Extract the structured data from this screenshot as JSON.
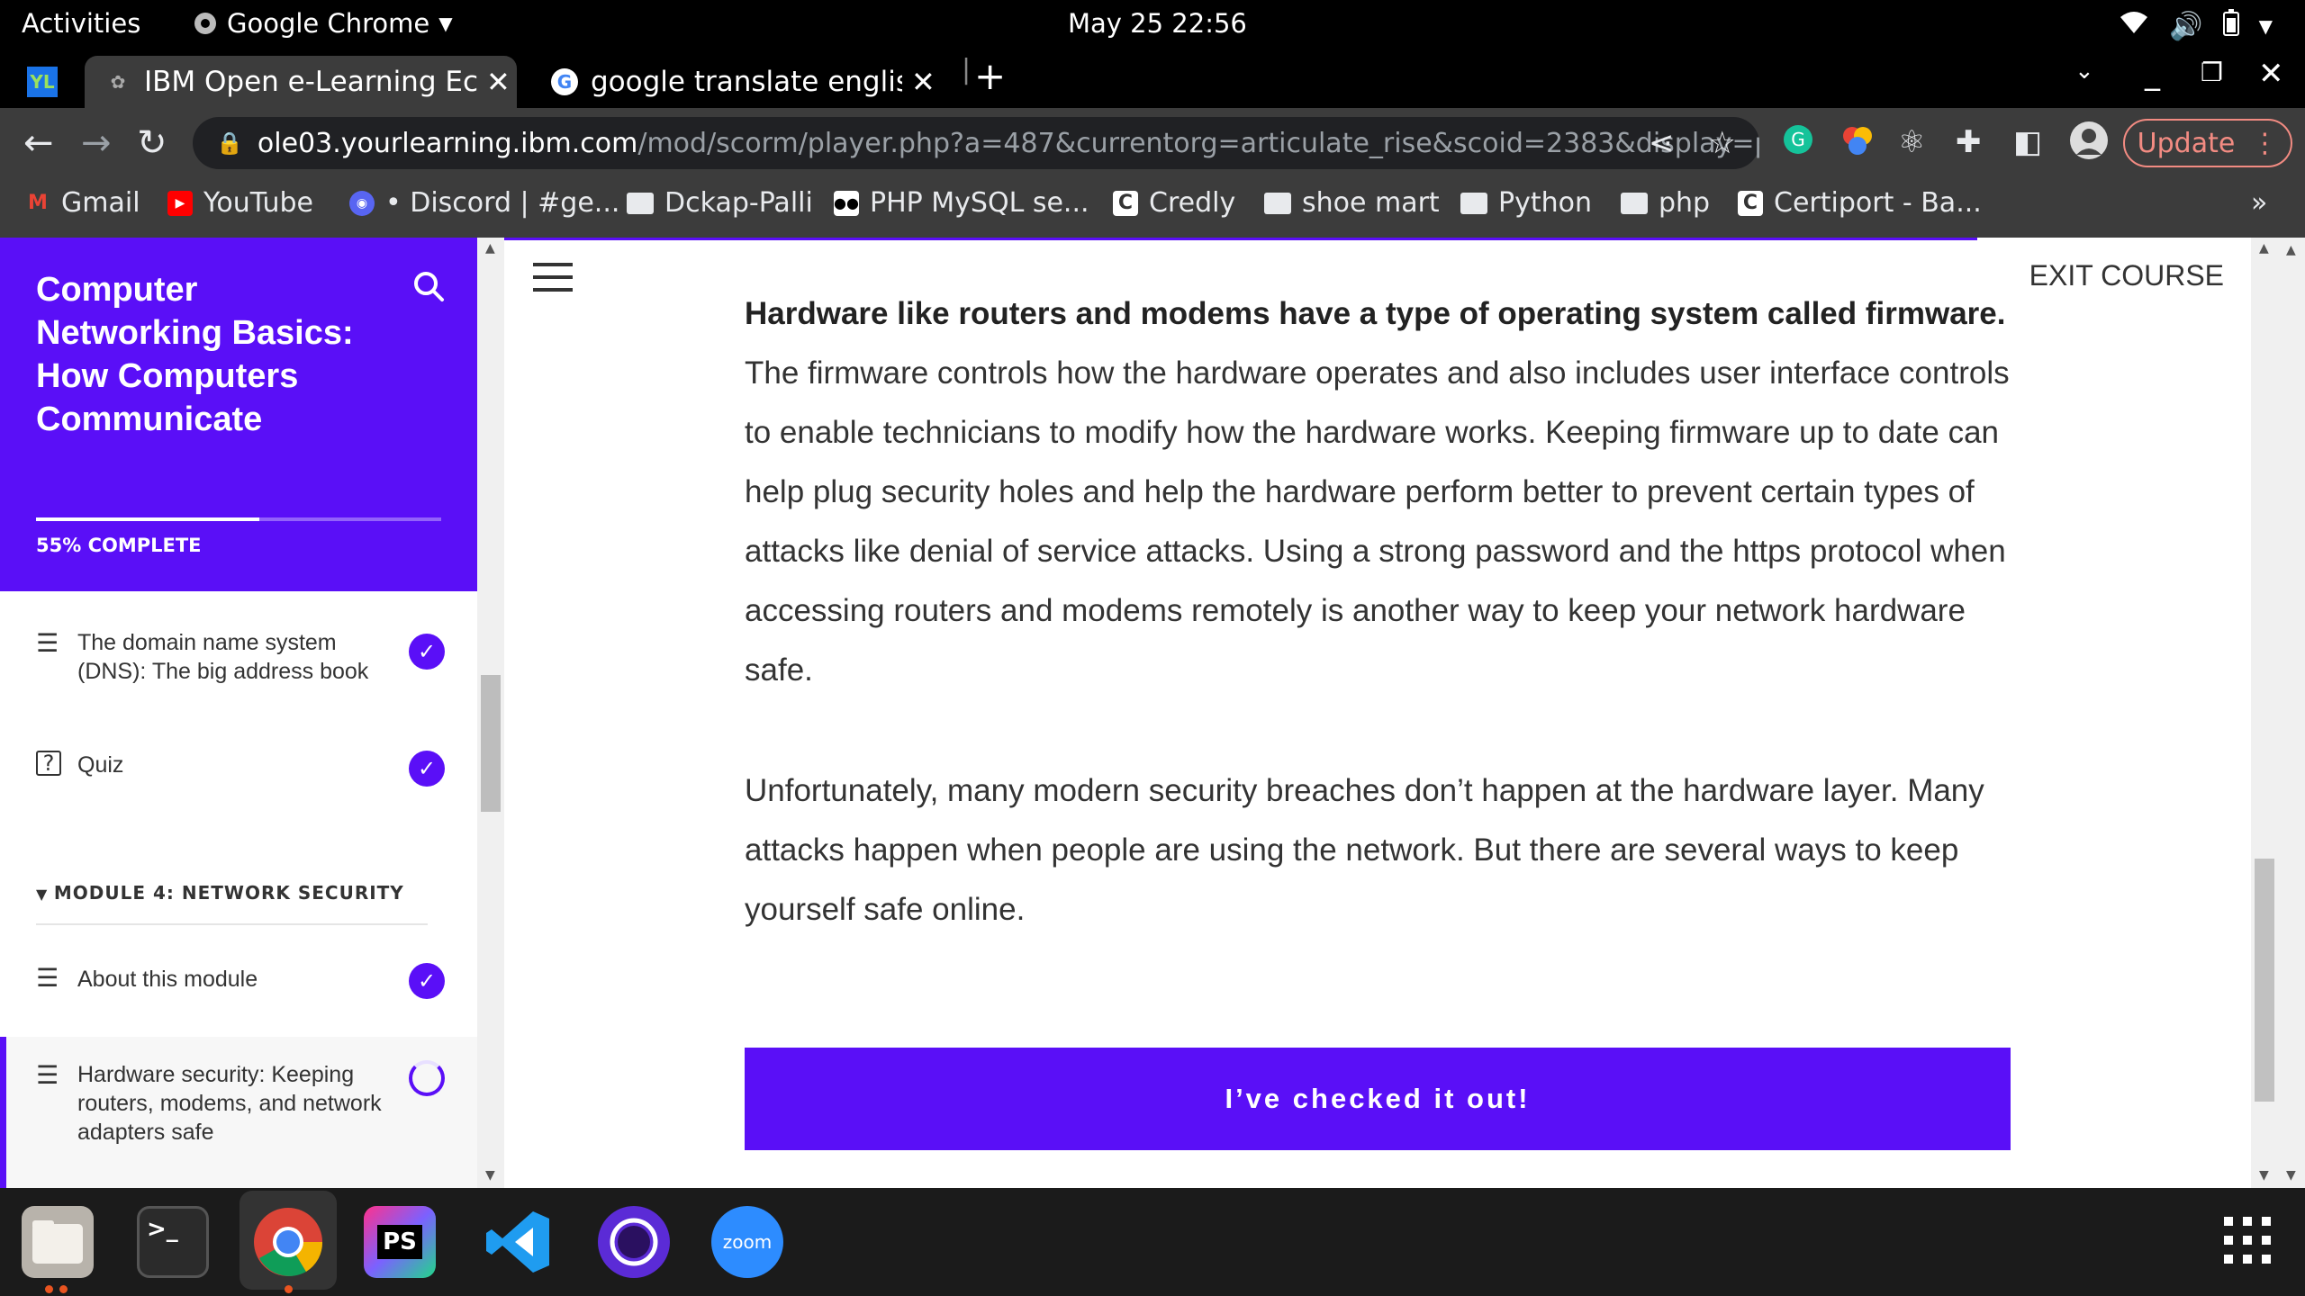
{
  "system_bar": {
    "activities": "Activities",
    "app_name": "Google Chrome",
    "clock": "May 25  22:56"
  },
  "tabs": [
    {
      "title": "IBM Open e-Learning Ecos"
    },
    {
      "title": "google translate english t"
    }
  ],
  "toolbar": {
    "url_host": "ole03.yourlearning.ibm.com",
    "url_path": "/mod/scorm/player.php?a=487&currentorg=articulate_rise&scoid=2383&display=popup&...",
    "update_label": "Update"
  },
  "bookmarks": [
    {
      "label": "Gmail"
    },
    {
      "label": "YouTube"
    },
    {
      "label": "• Discord | #ge..."
    },
    {
      "label": "Dckap-Palli"
    },
    {
      "label": "PHP MySQL se..."
    },
    {
      "label": "Credly"
    },
    {
      "label": "shoe mart"
    },
    {
      "label": "Python"
    },
    {
      "label": "php"
    },
    {
      "label": "Certiport - Ba..."
    }
  ],
  "bookmarks_more": "»",
  "sidebar": {
    "course_title": "Computer Networking Basics: How Computers Communicate",
    "progress_percent": 55,
    "progress_text": "55% COMPLETE",
    "lessons": [
      {
        "label": "The domain name system (DNS): The big address book",
        "icon": "lines-icon",
        "status": "complete"
      },
      {
        "label": "Quiz",
        "icon": "quiz-icon",
        "status": "complete"
      },
      {
        "label": "About this module",
        "icon": "lines-icon",
        "status": "complete"
      },
      {
        "label": "Hardware security: Keeping routers, modems, and network adapters safe",
        "icon": "lines-icon",
        "status": "in-progress"
      }
    ],
    "module_heading": "MODULE 4: NETWORK SECURITY"
  },
  "main": {
    "exit_label": "EXIT COURSE",
    "p1_bold": "Hardware like routers and modems have a type of operating system called firmware.",
    "p1_rest": " The firmware controls how the hardware operates and also includes user interface controls to enable technicians to modify how the hardware works. Keeping firmware up to date can help plug security holes and help the hardware perform better to prevent certain types of attacks like denial of service attacks. Using a strong password and the https protocol when accessing routers and modems remotely is another way to keep your network hardware safe.",
    "p2": "Unfortunately, many modern security breaches don’t happen at the hardware layer. Many attacks happen when people are using the network. But there are several ways to keep yourself safe online.",
    "cta_label": "I’ve checked it out!"
  },
  "dock": {
    "zoom_label": "zoom",
    "phpstorm_label": "PS"
  },
  "colors": {
    "accent": "#5a0ff7",
    "chrome_dark": "#3c3c3c",
    "update_red": "#f28b82"
  }
}
